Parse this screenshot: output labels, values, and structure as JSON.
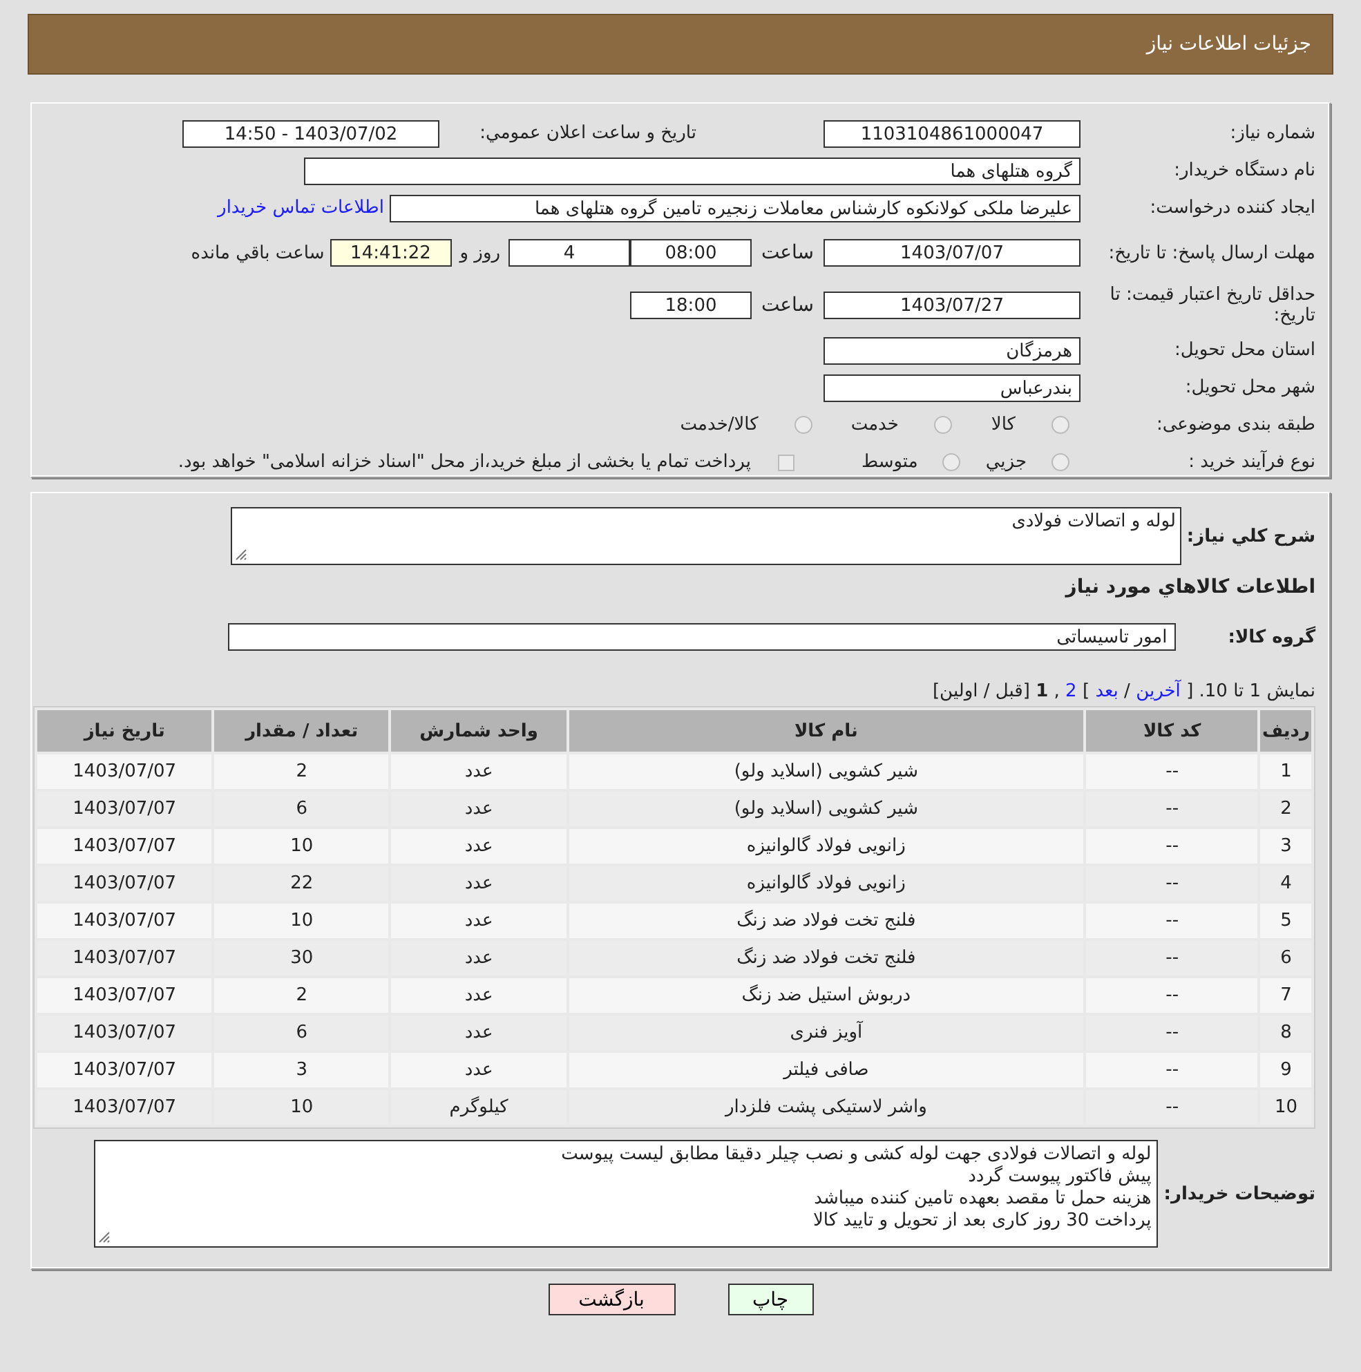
{
  "header": {
    "title": "جزئیات اطلاعات نیاز"
  },
  "form": {
    "need_number": {
      "label": "شماره نیاز:",
      "value": "1103104861000047"
    },
    "announce": {
      "label": "تاریخ و ساعت اعلان عمومي:",
      "value": "1403/07/02 - 14:50"
    },
    "buyer": {
      "label": "نام دستگاه خریدار:",
      "value": "گروه هتلهای هما"
    },
    "creator": {
      "label": "ایجاد کننده درخواست:",
      "value": "علیرضا ملکی کولانکوه کارشناس معاملات زنجیره تامین گروه هتلهای هما",
      "link": "اطلاعات تماس خریدار"
    },
    "deadline": {
      "label": "مهلت ارسال پاسخ: تا تاریخ:",
      "date": "1403/07/07",
      "time_label": "ساعت",
      "time": "08:00",
      "days": "4",
      "days_label": "روز و",
      "remaining": "14:41:22",
      "remaining_label": "ساعت باقي مانده"
    },
    "validity": {
      "label": "حداقل تاریخ اعتبار قیمت: تا تاریخ:",
      "date": "1403/07/27",
      "time_label": "ساعت",
      "time": "18:00"
    },
    "province": {
      "label": "استان محل تحویل:",
      "value": "هرمزگان"
    },
    "city": {
      "label": "شهر محل تحویل:",
      "value": "بندرعباس"
    },
    "category": {
      "label": "طبقه بندی موضوعی:",
      "options": [
        {
          "label": "کالا",
          "selected": false
        },
        {
          "label": "خدمت",
          "selected": false
        },
        {
          "label": "کالا/خدمت",
          "selected": false
        }
      ]
    },
    "process": {
      "label": "نوع فرآیند خرید :",
      "options": [
        {
          "label": "جزيي",
          "selected": false
        },
        {
          "label": "متوسط",
          "selected": false
        }
      ],
      "treasury": {
        "label": "پرداخت تمام یا بخشی از مبلغ خرید،از محل \"اسناد خزانه اسلامی\" خواهد بود.",
        "checked": false
      }
    }
  },
  "details": {
    "summary": {
      "label": "شرح کلي نياز:",
      "value": "لوله و اتصالات فولادی"
    },
    "goods_heading": "اطلاعات کالاهاي مورد نياز",
    "goods_group": {
      "label": "گروه کالا:",
      "value": "امور تاسیساتی"
    },
    "pagination": [
      {
        "kind": "text",
        "text": "نمایش 1 تا 10. ["
      },
      {
        "kind": "link",
        "text": "آخرین"
      },
      {
        "kind": "text",
        "text": "/"
      },
      {
        "kind": "link",
        "text": "بعد"
      },
      {
        "kind": "text",
        "text": "]"
      },
      {
        "kind": "link",
        "text": "2"
      },
      {
        "kind": "text",
        "text": ","
      },
      {
        "kind": "bold",
        "text": "1"
      },
      {
        "kind": "text",
        "text": "[قبل / اولین]"
      }
    ],
    "table": {
      "columns": [
        "ردیف",
        "کد کالا",
        "نام کالا",
        "واحد شمارش",
        "تعداد / مقدار",
        "تاریخ نیاز"
      ],
      "rows": [
        [
          "1",
          "--",
          "شیر کشویی (اسلاید ولو)",
          "عدد",
          "2",
          "1403/07/07"
        ],
        [
          "2",
          "--",
          "شیر کشویی (اسلاید ولو)",
          "عدد",
          "6",
          "1403/07/07"
        ],
        [
          "3",
          "--",
          "زانویی فولاد گالوانیزه",
          "عدد",
          "10",
          "1403/07/07"
        ],
        [
          "4",
          "--",
          "زانویی فولاد گالوانیزه",
          "عدد",
          "22",
          "1403/07/07"
        ],
        [
          "5",
          "--",
          "فلنج تخت فولاد ضد زنگ",
          "عدد",
          "10",
          "1403/07/07"
        ],
        [
          "6",
          "--",
          "فلنج تخت فولاد ضد زنگ",
          "عدد",
          "30",
          "1403/07/07"
        ],
        [
          "7",
          "--",
          "دربوش استیل ضد زنگ",
          "عدد",
          "2",
          "1403/07/07"
        ],
        [
          "8",
          "--",
          "آویز فنری",
          "عدد",
          "6",
          "1403/07/07"
        ],
        [
          "9",
          "--",
          "صافی فیلتر",
          "عدد",
          "3",
          "1403/07/07"
        ],
        [
          "10",
          "--",
          "واشر لاستیکی پشت فلزدار",
          "کیلوگرم",
          "10",
          "1403/07/07"
        ]
      ]
    },
    "buyer_notes": {
      "label": "توضیحات خریدار:",
      "lines": [
        "لوله و اتصالات فولادی جهت لوله کشی و نصب چیلر دقیقا مطابق لیست پیوست",
        "پیش فاکتور پیوست گردد",
        "هزینه حمل تا مقصد بعهده تامین کننده میباشد",
        "پرداخت 30 روز کاری بعد از تحویل و تایید کالا"
      ]
    }
  },
  "buttons": [
    {
      "kind": "print",
      "label": "چاپ"
    },
    {
      "kind": "back",
      "label": "بازگشت"
    }
  ]
}
